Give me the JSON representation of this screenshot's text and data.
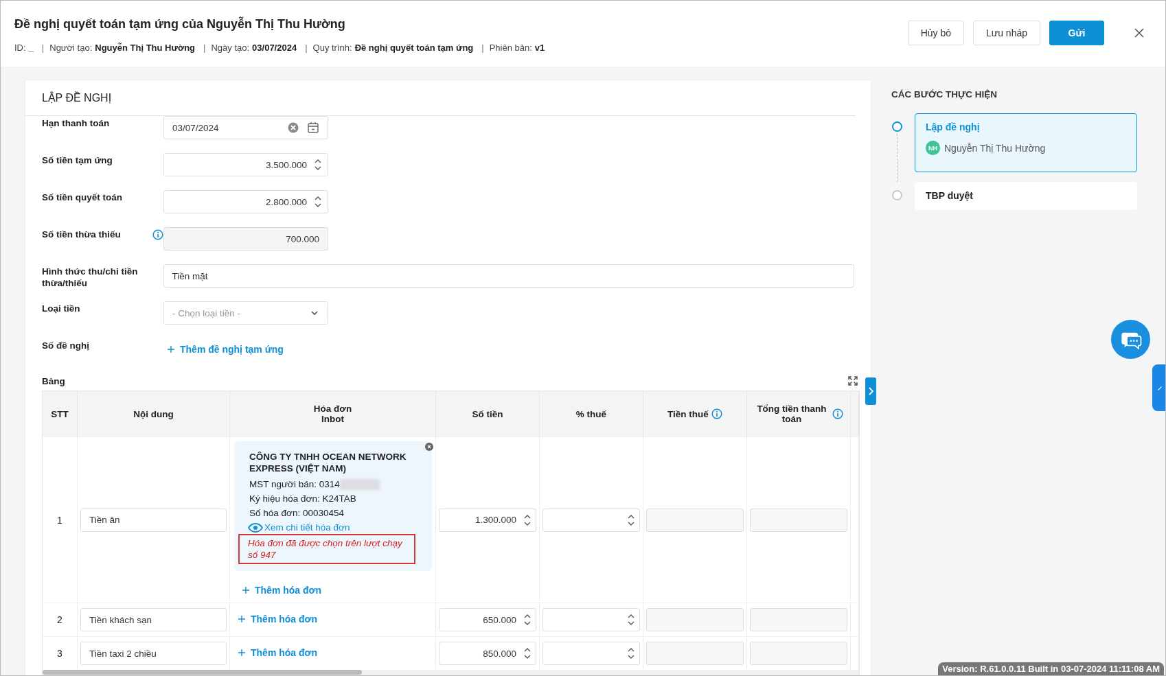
{
  "header": {
    "title": "Đề nghị quyết toán tạm ứng của Nguyễn Thị Thu Hường",
    "meta": [
      {
        "label": "ID:",
        "value": "_"
      },
      {
        "separator": "|",
        "label": "Người tạo:",
        "value": "Nguyễn Thị Thu Hường"
      },
      {
        "separator": "|",
        "label": "Ngày tạo:",
        "value": "03/07/2024"
      },
      {
        "separator": "|",
        "label": "Quy trình:",
        "value": "Đề nghị quyết toán tạm ứng"
      },
      {
        "separator": "|",
        "label": "Phiên bản:",
        "value": "v1"
      }
    ],
    "buttons": [
      {
        "label": "Hủy bỏ",
        "kind": "secondary"
      },
      {
        "label": "Lưu nháp",
        "kind": "secondary"
      },
      {
        "label": "Gửi",
        "kind": "primary"
      }
    ]
  },
  "form": {
    "heading": "LẬP ĐỀ NGHỊ",
    "fields": [
      {
        "label": "Hạn thanh toán",
        "kind": "date",
        "value": "03/07/2024"
      },
      {
        "label": "Số tiền tạm ứng",
        "kind": "number",
        "value": "3.500.000"
      },
      {
        "label": "Số tiền quyết toán",
        "kind": "number",
        "value": "2.800.000"
      },
      {
        "label": "Số tiền thừa thiếu",
        "kind": "readonly",
        "value": "700.000",
        "info": true
      },
      {
        "label": "Hình thức thu/chi tiền thừa/thiếu",
        "kind": "text",
        "value": "Tiền mặt"
      },
      {
        "label": "Loại tiền",
        "kind": "select",
        "placeholder": "- Chọn loại tiền -"
      },
      {
        "label": "Số đề nghị",
        "kind": "link",
        "value": "Thêm đề nghị tạm ứng"
      }
    ]
  },
  "table": {
    "label": "Bảng",
    "columns": [
      {
        "label": "STT"
      },
      {
        "label": "Nội dung"
      },
      {
        "label": "Hóa đơn\nInbot"
      },
      {
        "label": "Số tiền"
      },
      {
        "label": "% thuế"
      },
      {
        "label": "Tiền thuế",
        "info": true
      },
      {
        "label": "Tổng tiền thanh toán",
        "info": true
      }
    ],
    "rows": [
      {
        "stt": "1",
        "content": "Tiền ăn",
        "amount": "1.300.000",
        "add_invoice": "Thêm hóa đơn",
        "invoice": {
          "company": "CÔNG TY TNHH OCEAN NETWORK EXPRESS (VIỆT NAM)",
          "seller_tax_code": "MST người bán: 0314",
          "symbol": "Ký hiệu hóa đơn: K24TAB",
          "number": "Số hóa đơn: 00030454",
          "view_link": "Xem chi tiết hóa đơn",
          "error": "Hóa đơn đã được chọn trên lượt chạy số 947"
        }
      },
      {
        "stt": "2",
        "content": "Tiền khách sạn",
        "amount": "650.000",
        "add_invoice": "Thêm hóa đơn"
      },
      {
        "stt": "3",
        "content": "Tiền taxi 2 chiều",
        "amount": "850.000",
        "add_invoice": "Thêm hóa đơn"
      }
    ]
  },
  "steps": {
    "title": "CÁC BƯỚC THỰC HIỆN",
    "items": [
      {
        "name": "Lập đề nghị",
        "selected": true,
        "assignee": {
          "initials": "NH",
          "name": "Nguyễn Thị Thu Hường"
        }
      },
      {
        "name": "TBP duyệt",
        "selected": false
      }
    ]
  },
  "version": "Version: R.61.0.0.11 Built in 03-07-2024 11:11:08 AM"
}
